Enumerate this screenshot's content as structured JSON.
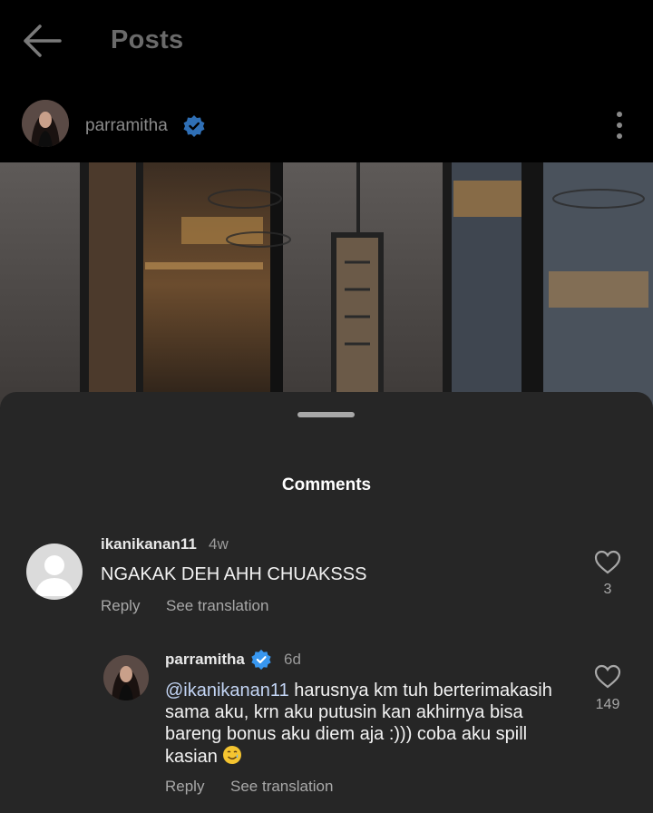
{
  "header": {
    "title": "Posts"
  },
  "post": {
    "username": "parramitha"
  },
  "comments_sheet": {
    "title": "Comments",
    "comments": [
      {
        "username": "ikanikanan11",
        "time": "4w",
        "text": "NGAKAK DEH AHH CHUAKSSS",
        "reply_label": "Reply",
        "translate_label": "See translation",
        "likes": "3"
      },
      {
        "username": "parramitha",
        "time": "6d",
        "mention": "@ikanikanan11",
        "text_line1": " harusnya km tuh berterimakasih",
        "text_line2": "sama aku, krn aku putusin kan akhirnya bisa",
        "text_line3": "bareng bonus aku diem aja :))) coba aku spill",
        "text_line4": "kasian",
        "emoji": "🥲",
        "reply_label": "Reply",
        "translate_label": "See translation",
        "likes": "149"
      }
    ]
  },
  "colors": {
    "background": "#000000",
    "sheet": "#262626",
    "verified": "#3897f0",
    "mention": "#c3d5f5"
  },
  "icons": [
    "back-arrow-icon",
    "verified-badge-icon",
    "more-options-icon",
    "heart-outline-icon",
    "default-avatar-icon"
  ]
}
